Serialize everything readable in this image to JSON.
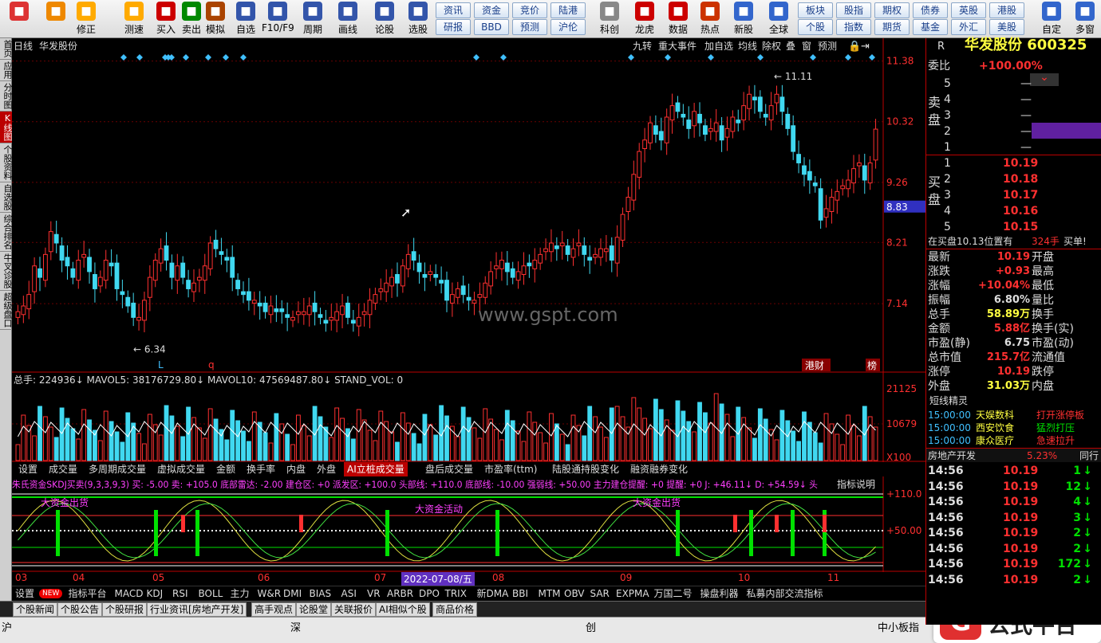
{
  "toolbar": {
    "buttons": [
      {
        "label": "",
        "icon": "app-icon"
      },
      {
        "label": "",
        "icon": "back-icon"
      },
      {
        "label": "修正",
        "icon": "fix-icon"
      },
      {
        "label": "测速",
        "icon": "clock-icon"
      },
      {
        "label": "买入",
        "icon": "buy-icon"
      },
      {
        "label": "卖出",
        "icon": "sell-icon"
      },
      {
        "label": "模拟",
        "icon": "hammer-icon"
      },
      {
        "label": "自选",
        "icon": "house-icon"
      },
      {
        "label": "F10/F9",
        "icon": "f10-icon"
      },
      {
        "label": "周期",
        "icon": "cycle-icon"
      },
      {
        "label": "画线",
        "icon": "pen-icon"
      },
      {
        "label": "论股",
        "icon": "talk-icon"
      },
      {
        "label": "选股",
        "icon": "select-icon"
      },
      {
        "label": "科创",
        "icon": "chart-icon"
      },
      {
        "label": "龙虎",
        "icon": "dragon-icon"
      },
      {
        "label": "数据",
        "icon": "pe-icon"
      },
      {
        "label": "热点",
        "icon": "hot-icon"
      },
      {
        "label": "新股",
        "icon": "ipo-icon"
      },
      {
        "label": "全球",
        "icon": "globe-icon"
      },
      {
        "label": "自定",
        "icon": "custom-icon"
      },
      {
        "label": "多窗",
        "icon": "window-icon"
      }
    ],
    "quick": [
      "资讯",
      "资金",
      "竞价",
      "陆港",
      "研报",
      "BBD",
      "预测",
      "沪伦",
      "板块",
      "股指",
      "期权",
      "债券",
      "英股",
      "港股",
      "个股",
      "指数",
      "期货",
      "基金",
      "外汇",
      "美股"
    ]
  },
  "leftbar": [
    "首页",
    "应用",
    "分时图",
    "K线图",
    "个股资料",
    "自选股",
    "综合排名",
    "牛叉诊股",
    "超级盘口"
  ],
  "chart": {
    "period": "日线",
    "name": "华发股份",
    "menu": [
      "九转",
      "重大事件",
      "加自选",
      "均线",
      "除权",
      "叠",
      "窗",
      "预测"
    ],
    "price_axis": [
      "11.38",
      "10.32",
      "9.26",
      "8.83",
      "8.21",
      "7.14"
    ],
    "high_label": "11.11",
    "low_label": "6.34",
    "watermark": "www.gspt.com",
    "marks": [
      "L",
      "q"
    ],
    "tags": [
      "港财",
      "榜"
    ]
  },
  "volume": {
    "title": "总手: 224936↓ MAVOL5: 38176729.80↓ MAVOL10: 47569487.80↓ STAND_VOL: 0",
    "axis": [
      "21125",
      "10679",
      "X100"
    ]
  },
  "subtabs": [
    "设置",
    "成交量",
    "多周期成交量",
    "虚拟成交量",
    "金额",
    "换手率",
    "内盘",
    "外盘",
    "AI立桩成交量",
    "盘后成交量",
    "市盈率(ttm)",
    "陆股通持股变化",
    "融资融券变化"
  ],
  "indicator": {
    "title": "朱氏资金SKDJ买卖(9,3,3,9,3) 买: -5.00 卖: +105.0 底部雷达: -2.00 建仓区: +0 派发区: +100.0 头部线: +110.0 底部线: -10.00 强弱线: +50.00 主力建仓提醒: +0 提醒: +0 J: +46.11↓ D: +54.59↓ 头",
    "help": "指标说明",
    "axis": [
      "110.0",
      "50.00"
    ],
    "notes": [
      "大资金出货",
      "大资金活动",
      "大资金出货"
    ]
  },
  "xaxis": [
    "03",
    "04",
    "05",
    "06",
    "07",
    "08",
    "09",
    "10",
    "11"
  ],
  "cursor_date": "2022-07-08/五",
  "indtabs": [
    "设置",
    "NEW",
    "指标平台",
    "MACD",
    "KDJ",
    "RSI",
    "BOLL",
    "主力",
    "W&R",
    "DMI",
    "BIAS",
    "ASI",
    "VR",
    "ARBR",
    "DPO",
    "TRIX",
    "新DMA",
    "BBI",
    "MTM",
    "OBV",
    "SAR",
    "EXPMA",
    "万国二号",
    "操盘利器",
    "私募内部交流指标"
  ],
  "bottomtabs": [
    "个股新闻",
    "个股公告",
    "个股研报",
    "行业资讯[房地产开发]",
    "高手观点",
    "论股堂",
    "关联报价",
    "AI相似个股",
    "商品价格"
  ],
  "status": {
    "items": [
      "沪",
      "深",
      "创",
      "中小板指"
    ],
    "brand": "公式平台"
  },
  "quote": {
    "header": "R",
    "name": "华发股份 600325",
    "weibi_label": "委比",
    "weibi": "+100.00%",
    "sell_label": "卖盘",
    "buy_label": "买盘",
    "sell": [
      {
        "n": "5",
        "p": "",
        "v": "—"
      },
      {
        "n": "4",
        "p": "",
        "v": "—"
      },
      {
        "n": "3",
        "p": "",
        "v": "—"
      },
      {
        "n": "2",
        "p": "",
        "v": "—"
      },
      {
        "n": "1",
        "p": "",
        "v": "—"
      }
    ],
    "buy": [
      {
        "n": "1",
        "p": "10.19"
      },
      {
        "n": "2",
        "p": "10.18"
      },
      {
        "n": "3",
        "p": "10.17"
      },
      {
        "n": "4",
        "p": "10.16"
      },
      {
        "n": "5",
        "p": "10.15"
      }
    ],
    "queue": "在买盘10.13位置有",
    "queue_vol": "324手",
    "queue_btn": "买单!",
    "stats": [
      [
        "最新",
        "10.19",
        "开盘"
      ],
      [
        "涨跌",
        "+0.93",
        "最高"
      ],
      [
        "涨幅",
        "+10.04%",
        "最低"
      ],
      [
        "振幅",
        "6.80%",
        "量比"
      ],
      [
        "总手",
        "58.89万",
        "换手"
      ],
      [
        "金额",
        "5.88亿",
        "换手(实)"
      ],
      [
        "市盈(静)",
        "6.75",
        "市盈(动)"
      ],
      [
        "总市值",
        "215.7亿",
        "流通值"
      ],
      [
        "涨停",
        "10.19",
        "跌停"
      ],
      [
        "外盘",
        "31.03万",
        "内盘"
      ]
    ],
    "short_title": "短线精灵",
    "short": [
      [
        "15:00:00",
        "天娱数科",
        "打开涨停板"
      ],
      [
        "15:00:00",
        "西安饮食",
        "猛烈打压"
      ],
      [
        "15:00:00",
        "康众医疗",
        "急速拉升"
      ]
    ],
    "sector": "房地产开发",
    "sector_pct": "5.23%",
    "sector_tab": "同行",
    "ticks": [
      [
        "14:56",
        "10.19",
        "1"
      ],
      [
        "14:56",
        "10.19",
        "12"
      ],
      [
        "14:56",
        "10.19",
        "4"
      ],
      [
        "14:56",
        "10.19",
        "3"
      ],
      [
        "14:56",
        "10.19",
        "2"
      ],
      [
        "14:56",
        "10.19",
        "2"
      ],
      [
        "14:56",
        "10.19",
        "172"
      ],
      [
        "14:56",
        "10.19",
        "2"
      ]
    ]
  },
  "colors": {
    "up": "#ff3030",
    "down": "#40d8f0",
    "accent": "#b00000"
  }
}
